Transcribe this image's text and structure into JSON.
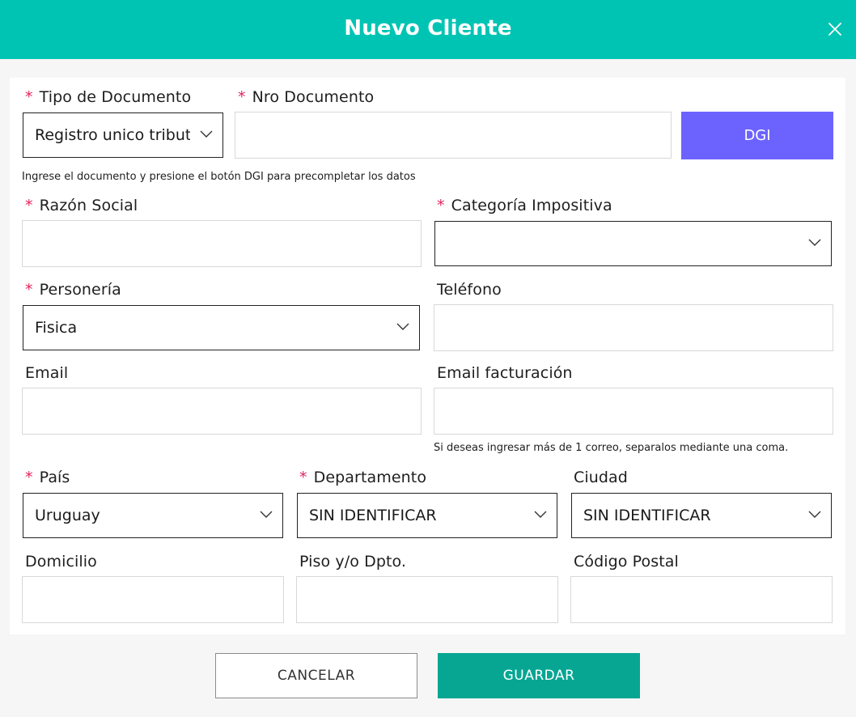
{
  "header": {
    "title": "Nuevo Cliente"
  },
  "form": {
    "tipo_documento": {
      "label": "Tipo de Documento",
      "value": "Registro unico tributario"
    },
    "nro_documento": {
      "label": "Nro Documento",
      "value": ""
    },
    "dgi_button": "DGI",
    "documento_hint": "Ingrese el documento y presione el botón DGI para precompletar los datos",
    "razon_social": {
      "label": "Razón Social",
      "value": ""
    },
    "categoria_impositiva": {
      "label": "Categoría Impositiva",
      "value": ""
    },
    "personeria": {
      "label": "Personería",
      "value": "Fisica"
    },
    "telefono": {
      "label": "Teléfono",
      "value": ""
    },
    "email": {
      "label": "Email",
      "value": ""
    },
    "email_facturacion": {
      "label": "Email facturación",
      "value": ""
    },
    "email_hint": "Si deseas ingresar más de 1 correo, separalos mediante una coma.",
    "pais": {
      "label": "País",
      "value": "Uruguay"
    },
    "departamento": {
      "label": "Departamento",
      "value": "SIN IDENTIFICAR"
    },
    "ciudad": {
      "label": "Ciudad",
      "value": "SIN IDENTIFICAR"
    },
    "domicilio": {
      "label": "Domicilio",
      "value": ""
    },
    "piso_dpto": {
      "label": "Piso y/o Dpto.",
      "value": ""
    },
    "codigo_postal": {
      "label": "Código Postal",
      "value": ""
    },
    "required_mark": "*"
  },
  "actions": {
    "cancel": "CANCELAR",
    "save": "GUARDAR"
  },
  "colors": {
    "header": "#00c4b3",
    "dgi": "#6c63ff",
    "save": "#06a693",
    "required": "#e3245e"
  },
  "icons": {
    "close": "close-icon",
    "dropdown": "chevron-down-icon"
  }
}
